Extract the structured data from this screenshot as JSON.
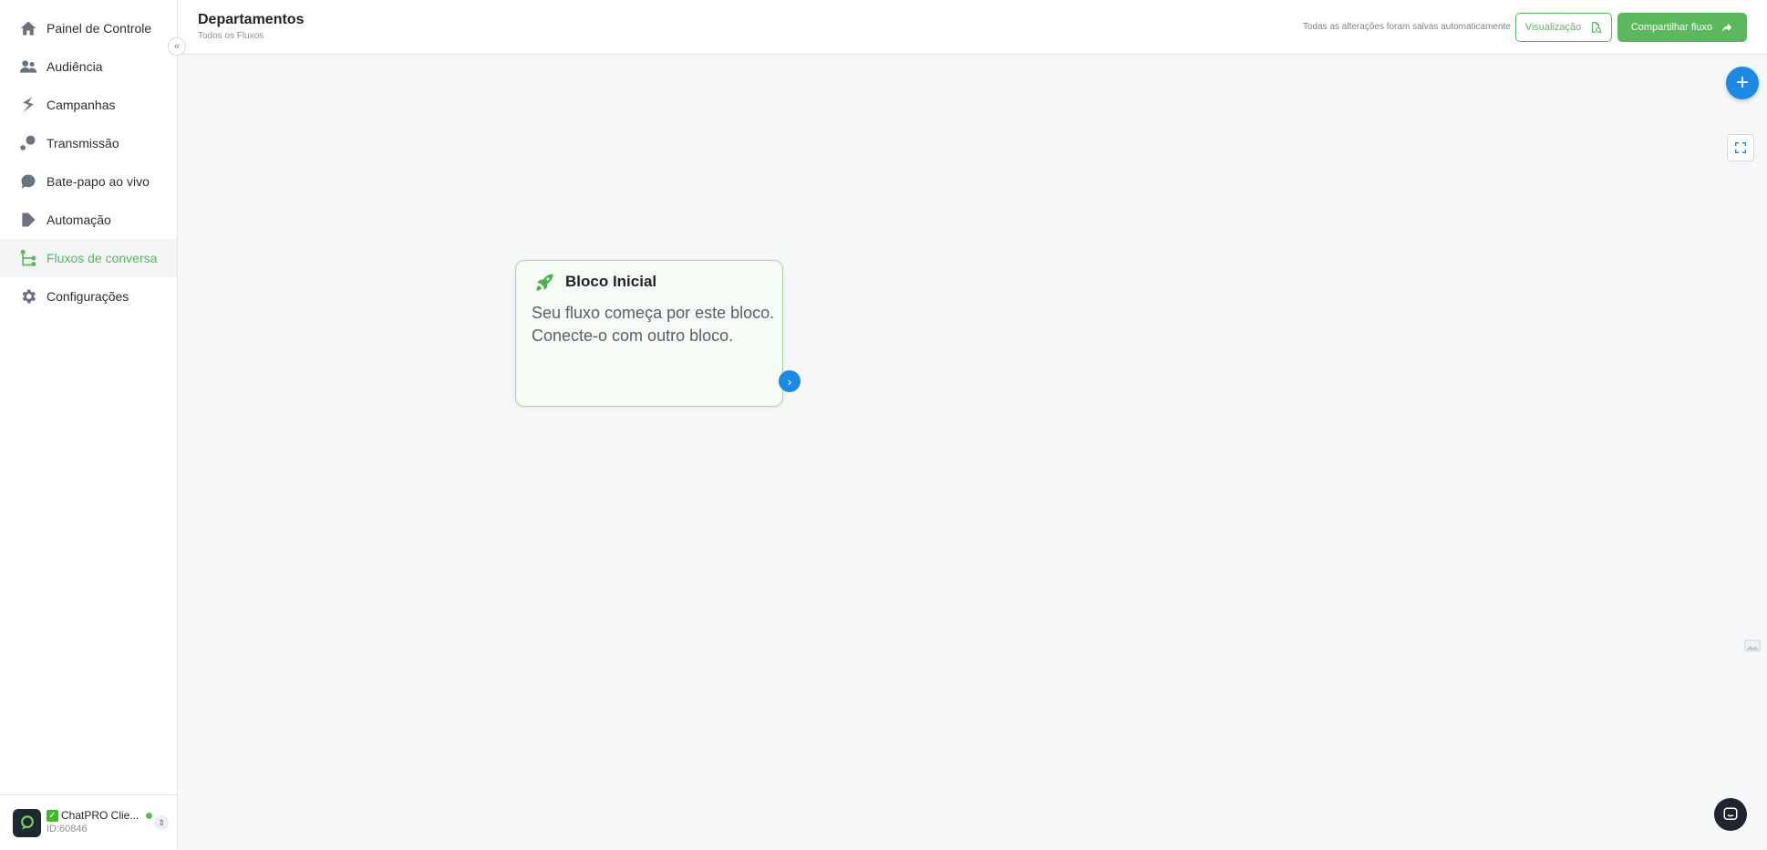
{
  "sidebar": {
    "items": [
      {
        "label": "Painel de Controle",
        "icon": "home-icon",
        "active": false
      },
      {
        "label": "Audiência",
        "icon": "users-icon",
        "active": false
      },
      {
        "label": "Campanhas",
        "icon": "campaign-icon",
        "active": false
      },
      {
        "label": "Transmissão",
        "icon": "broadcast-icon",
        "active": false
      },
      {
        "label": "Bate-papo ao vivo",
        "icon": "chat-icon",
        "active": false
      },
      {
        "label": "Automação",
        "icon": "automation-icon",
        "active": false
      },
      {
        "label": "Fluxos de conversa",
        "icon": "flow-icon",
        "active": true
      },
      {
        "label": "Configurações",
        "icon": "gear-icon",
        "active": false
      }
    ],
    "collapse_glyph": "«",
    "account": {
      "name": "ChatPRO Clie...",
      "id": "ID:60846",
      "status_color": "#5cb85c"
    }
  },
  "header": {
    "title": "Departamentos",
    "breadcrumb": "Todos os Fluxos",
    "saved_status": "Todas as alterações foram salvas automaticamente",
    "preview_label": "Visualização",
    "share_label": "Compartilhar fluxo"
  },
  "canvas": {
    "add_glyph": "+",
    "start_block": {
      "title": "Bloco Inicial",
      "description": "Seu fluxo começa por este bloco. Conecte-o com outro bloco.",
      "connector_glyph": "›"
    }
  },
  "colors": {
    "accent_green": "#5cb85c",
    "accent_blue": "#1e88e5"
  }
}
